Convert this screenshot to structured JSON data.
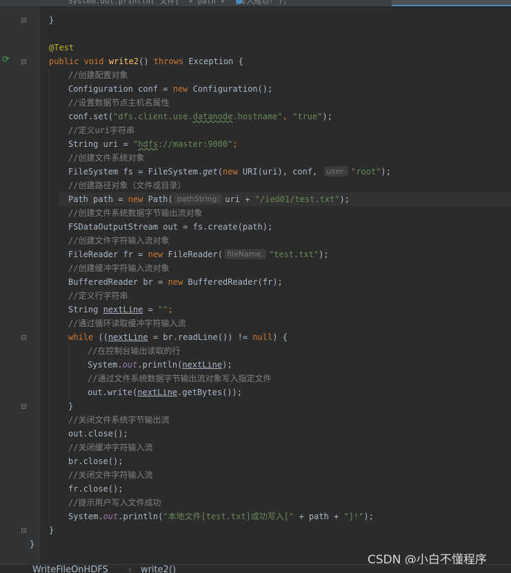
{
  "editor": {
    "tab_top_text": "System.out.println(\"文件[\" + path + \"]写入成功!\");",
    "lines": {
      "l1": "}",
      "annotation": "@Test",
      "sig_public": "public",
      "sig_void": "void",
      "sig_method": "write2",
      "sig_paren": "() ",
      "sig_throws": "throws",
      "sig_rest": " Exception {",
      "c_conf": "//创建配置对象",
      "conf_a": "Configuration conf = ",
      "kw_new": "new",
      "conf_b": " Configuration();",
      "c_hostname": "//设置数据节点主机名属性",
      "set_a": "conf.set(",
      "set_str1a": "\"dfs.client.use.",
      "set_str1b": "datanode",
      "set_str1c": ".hostname\"",
      "set_comma": ", ",
      "set_str2": "\"true\"",
      "set_end": ");",
      "c_uri": "//定义uri字符串",
      "uri_a": "String uri = ",
      "uri_q": "\"",
      "uri_b": "hdfs",
      "uri_c": "://master:9000\"",
      "uri_end": ";",
      "c_fs": "//创建文件系统对象",
      "fs_a": "FileSystem fs = FileSystem.",
      "fs_get": "get",
      "fs_b": "(",
      "fs_c": " URI(uri), conf, ",
      "fs_hint": "user:",
      "fs_str": "\"root\"",
      "fs_end": ");",
      "c_path": "//创建路径对象（文件或目录）",
      "path_a": "Path path = ",
      "path_b": " Path(",
      "path_hint": "pathString:",
      "path_c": "uri + ",
      "path_str": "\"/ied01/test.txt\"",
      "path_end": ");",
      "c_out": "//创建文件系统数据字节输出流对象",
      "out_line": "FSDataOutputStream out = fs.create(path);",
      "c_fr": "//创建文件字符输入流对象",
      "fr_a": "FileReader fr = ",
      "fr_b": " FileReader(",
      "fr_hint": "fileName:",
      "fr_str": "\"test.txt\"",
      "fr_end": ");",
      "c_br": "//创建缓冲字符输入流对象",
      "br_a": "BufferedReader br = ",
      "br_b": " BufferedReader(fr);",
      "c_line": "//定义行字符串",
      "nl_a": "String ",
      "nl_var": "nextLine",
      "nl_b": " = ",
      "nl_str": "\"\"",
      "nl_end": ";",
      "c_loop": "//通过循环读取缓冲字符输入流",
      "wh_kw": "while",
      "wh_a": " ((",
      "wh_var": "nextLine",
      "wh_b": " = br.readLine()) != ",
      "wh_null": "null",
      "wh_c": ") {",
      "c_print": "//在控制台输出读取的行",
      "pr_a": "System.",
      "pr_out": "out",
      "pr_b": ".println(",
      "pr_var": "nextLine",
      "pr_end": ");",
      "c_write": "//通过文件系统数据字节输出流对象写入指定文件",
      "wr_a": "out.write(",
      "wr_var": "nextLine",
      "wr_b": ".getBytes());",
      "brace_close": "}",
      "c_close_out": "//关闭文件系统字节输出流",
      "close_out": "out.close();",
      "c_close_br": "//关闭缓冲字符输入流",
      "close_br": "br.close();",
      "c_close_fr": "//关闭文件字符输入流",
      "close_fr": "fr.close();",
      "c_success": "//提示用户写入文件成功",
      "ok_a": "System.",
      "ok_out": "out",
      "ok_b": ".println(",
      "ok_str1": "\"本地文件[test.txt]成功写入[\"",
      "ok_c": " + path + ",
      "ok_str2": "\"]!\"",
      "ok_end": ");",
      "method_close": "}",
      "class_close": "}"
    }
  },
  "breadcrumb": {
    "class_name": "WriteFileOnHDFS",
    "separator": "›",
    "method_name": "write2()"
  },
  "watermark": {
    "text": "CSDN @小白不懂程序"
  },
  "colors": {
    "background": "#2b2b2b",
    "keyword": "#cc7832",
    "string": "#6a8759",
    "comment": "#808080",
    "method": "#ffc66d",
    "annotation": "#bbb529",
    "field": "#9876aa"
  }
}
